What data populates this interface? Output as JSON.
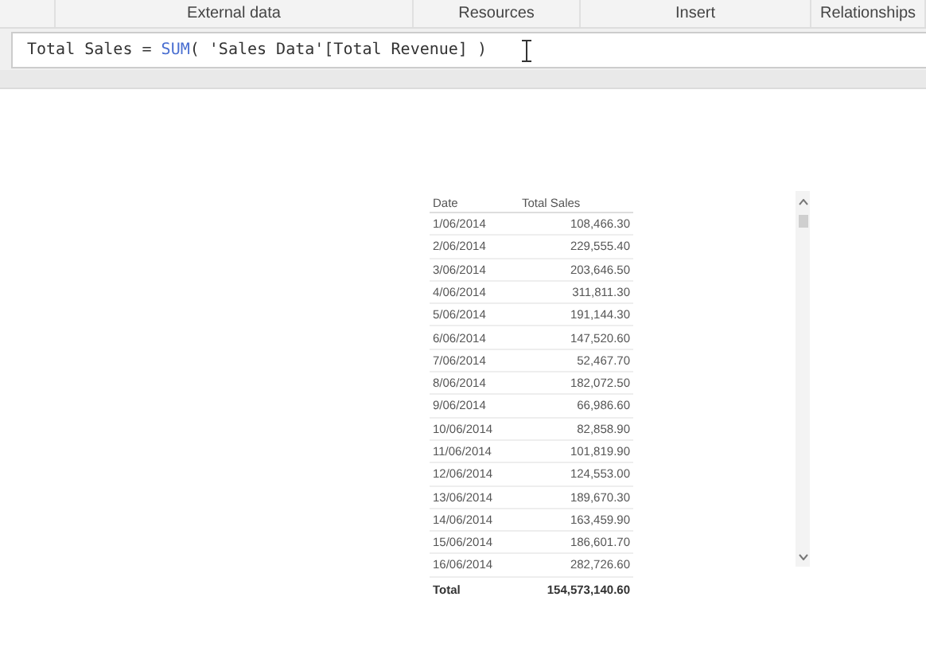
{
  "ribbon_groups": [
    "External data",
    "Resources",
    "Insert",
    "Relationships"
  ],
  "formula_bar": {
    "tokens": [
      {
        "kind": "text",
        "text": "Total Sales = "
      },
      {
        "kind": "function",
        "text": "SUM"
      },
      {
        "kind": "text",
        "text": "( 'Sales Data'[Total Revenue] )"
      }
    ]
  },
  "table": {
    "columns": [
      "Date",
      "Total Sales"
    ],
    "rows": [
      [
        "1/06/2014",
        "108,466.30"
      ],
      [
        "2/06/2014",
        "229,555.40"
      ],
      [
        "3/06/2014",
        "203,646.50"
      ],
      [
        "4/06/2014",
        "311,811.30"
      ],
      [
        "5/06/2014",
        "191,144.30"
      ],
      [
        "6/06/2014",
        "147,520.60"
      ],
      [
        "7/06/2014",
        "52,467.70"
      ],
      [
        "8/06/2014",
        "182,072.50"
      ],
      [
        "9/06/2014",
        "66,986.60"
      ],
      [
        "10/06/2014",
        "82,858.90"
      ],
      [
        "11/06/2014",
        "101,819.90"
      ],
      [
        "12/06/2014",
        "124,553.00"
      ],
      [
        "13/06/2014",
        "189,670.30"
      ],
      [
        "14/06/2014",
        "163,459.90"
      ],
      [
        "15/06/2014",
        "186,601.70"
      ],
      [
        "16/06/2014",
        "282,726.60"
      ]
    ],
    "total": [
      "Total",
      "154,573,140.60"
    ]
  }
}
